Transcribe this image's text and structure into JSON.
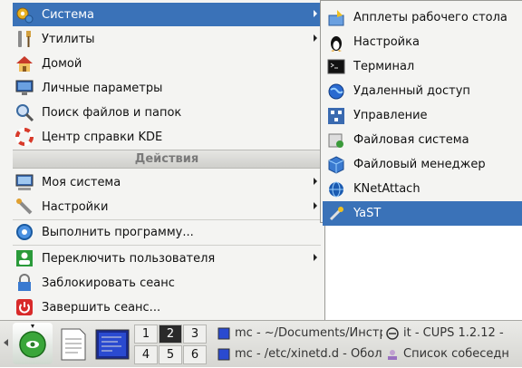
{
  "main_menu": {
    "items": [
      {
        "label": "Система"
      },
      {
        "label": "Утилиты"
      },
      {
        "label": "Домой"
      },
      {
        "label": "Личные параметры"
      },
      {
        "label": "Поиск файлов и папок"
      },
      {
        "label": "Центр справки KDE"
      }
    ],
    "section_header": "Действия",
    "action_items": [
      {
        "label": "Моя система"
      },
      {
        "label": "Настройки"
      },
      {
        "label": "Выполнить программу..."
      },
      {
        "label": "Переключить пользователя"
      },
      {
        "label": "Заблокировать сеанс"
      },
      {
        "label": "Завершить сеанс..."
      }
    ]
  },
  "submenu": {
    "items": [
      {
        "label": "Апплеты рабочего стола"
      },
      {
        "label": "Настройка"
      },
      {
        "label": "Терминал"
      },
      {
        "label": "Удаленный доступ"
      },
      {
        "label": "Управление"
      },
      {
        "label": "Файловая система"
      },
      {
        "label": "Файловый менеджер"
      },
      {
        "label": "KNetAttach"
      },
      {
        "label": "YaST"
      }
    ]
  },
  "taskbar": {
    "pager": [
      "1",
      "2",
      "3",
      "4",
      "5",
      "6"
    ],
    "tasks": [
      {
        "label": "mc - ~/Documents/Инстру"
      },
      {
        "label": "mc - /etc/xinetd.d - Оболо"
      },
      {
        "label": "it - CUPS 1.2.12 -"
      },
      {
        "label": "Список собеседн"
      }
    ]
  },
  "colors": {
    "selection": "#3a72b8",
    "menu_bg": "#f4f4f2"
  }
}
